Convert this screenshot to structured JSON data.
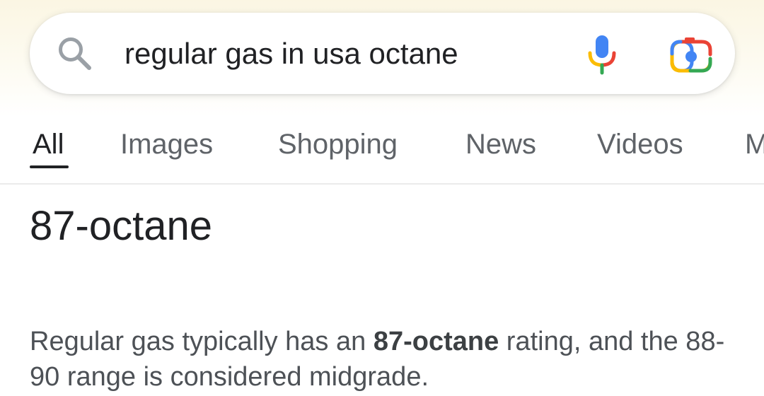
{
  "search": {
    "query": "regular gas in usa octane"
  },
  "tabs": [
    {
      "label": "All",
      "active": true
    },
    {
      "label": "Images",
      "active": false
    },
    {
      "label": "Shopping",
      "active": false
    },
    {
      "label": "News",
      "active": false
    },
    {
      "label": "Videos",
      "active": false
    },
    {
      "label": "M",
      "active": false
    }
  ],
  "result": {
    "answer": "87-octane",
    "snippet_before": "Regular gas typically has an ",
    "snippet_bold": "87-octane",
    "snippet_after": " rating, and the 88-90 range is considered midgrade."
  },
  "icons": {
    "search": "search-icon",
    "mic": "microphone-icon",
    "lens": "camera-lens-icon"
  },
  "colors": {
    "google_blue": "#4285f4",
    "google_red": "#ea4335",
    "google_yellow": "#fbbc05",
    "google_green": "#34a853"
  }
}
